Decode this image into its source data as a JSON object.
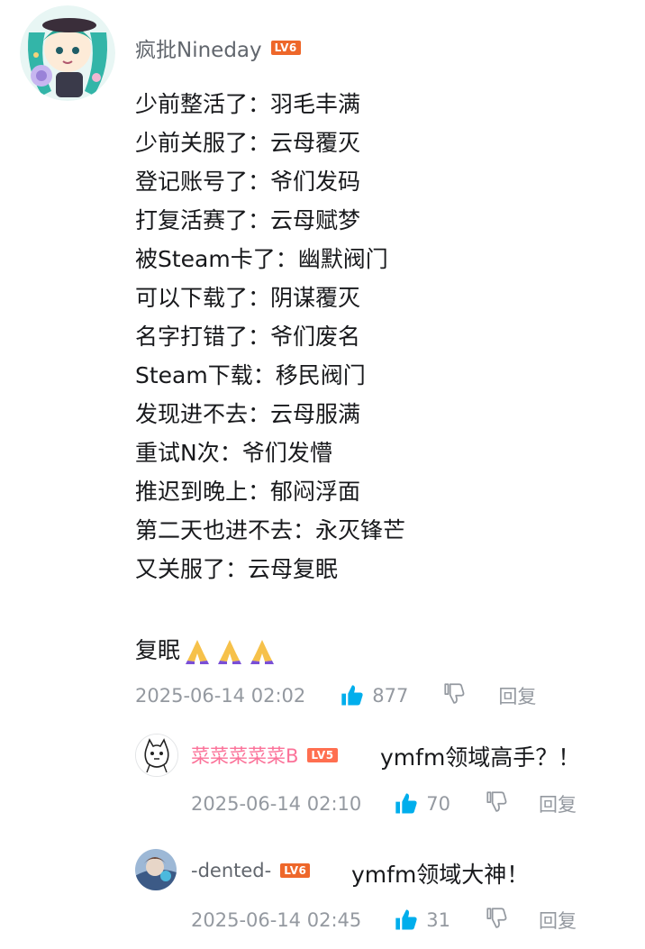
{
  "main": {
    "username": "疯批Nineday",
    "level": "LV6",
    "lines": [
      "少前整活了：羽毛丰满",
      "少前关服了：云母覆灭",
      "登记账号了：爷们发码",
      "打复活赛了：云母赋梦",
      "被Steam卡了：幽默阀门",
      "可以下载了：阴谋覆灭",
      "名字打错了：爷们废名",
      "Steam下载：移民阀门",
      "发现进不去：云母服满",
      "重试N次：爷们发懵",
      "推迟到晚上：郁闷浮面",
      "第二天也进不去：永灭锋芒",
      "又关服了：云母复眠"
    ],
    "tail_text": "复眠",
    "date": "2025-06-14 02:02",
    "likes": "877",
    "reply_label": "回复"
  },
  "replies": [
    {
      "username": "菜菜菜菜菜B",
      "level": "LV5",
      "text": "ymfm领域高手？！",
      "date": "2025-06-14 02:10",
      "likes": "70",
      "reply_label": "回复"
    },
    {
      "username": "-dented-",
      "level": "LV6",
      "text": "ymfm领域大神！",
      "date": "2025-06-14 02:45",
      "likes": "31",
      "reply_label": "回复"
    }
  ],
  "colors": {
    "like_blue": "#00aeec",
    "meta_gray": "#9499a0",
    "pink_name": "#fb7299",
    "level_orange": "#ee672a"
  },
  "icons": [
    "thumbs-up-icon",
    "thumbs-down-icon",
    "folded-hands-emoji"
  ]
}
